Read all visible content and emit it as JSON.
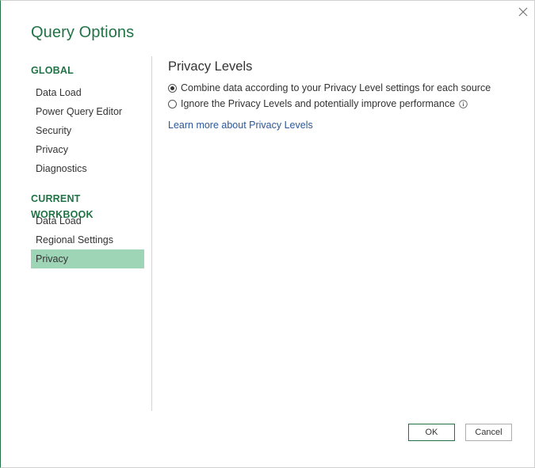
{
  "dialog": {
    "title": "Query Options"
  },
  "nav": {
    "global_header": "GLOBAL",
    "global_items": [
      {
        "label": "Data Load"
      },
      {
        "label": "Power Query Editor"
      },
      {
        "label": "Security"
      },
      {
        "label": "Privacy"
      },
      {
        "label": "Diagnostics"
      }
    ],
    "workbook_header": "CURRENT WORKBOOK",
    "workbook_items": [
      {
        "label": "Data Load"
      },
      {
        "label": "Regional Settings"
      },
      {
        "label": "Privacy",
        "selected": true
      }
    ]
  },
  "content": {
    "section_title": "Privacy Levels",
    "options": [
      {
        "label": "Combine data according to your Privacy Level settings for each source",
        "checked": true
      },
      {
        "label": "Ignore the Privacy Levels and potentially improve performance",
        "checked": false
      }
    ],
    "learn_more": "Learn more about Privacy Levels"
  },
  "buttons": {
    "ok": "OK",
    "cancel": "Cancel"
  },
  "colors": {
    "accent": "#217346",
    "selected_bg": "#9fd5b7",
    "link": "#2b5797"
  },
  "icons": {
    "close": "close-icon",
    "info": "info-icon"
  }
}
